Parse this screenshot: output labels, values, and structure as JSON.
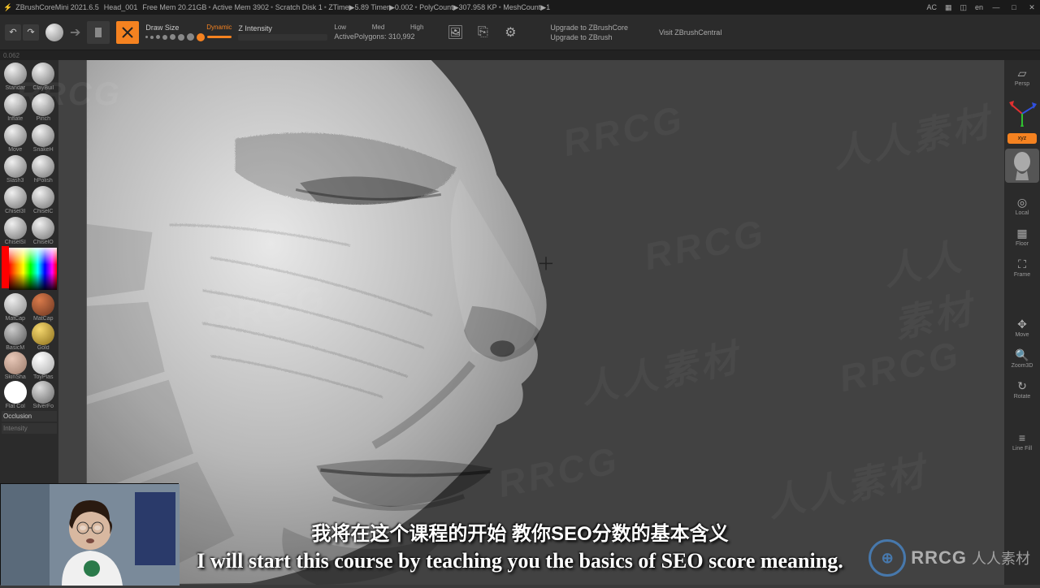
{
  "titlebar": {
    "app": "ZBrushCoreMini 2021.6.5",
    "doc": "Head_001",
    "items": [
      "Free Mem 20.21GB",
      "Active Mem 3902",
      "Scratch Disk 1",
      "ZTime▶5.89 Timer▶0.002",
      "PolyCount▶307.958 KP",
      "MeshCount▶1"
    ],
    "lang": "en",
    "ac": "AC"
  },
  "toolbar": {
    "draw_size_label": "Draw Size",
    "dynamic_label": "Dynamic",
    "z_intensity_label": "Z Intensity",
    "z_labels": [
      "Low",
      "Med",
      "High"
    ],
    "active_polygons_label": "ActivePolygons:",
    "active_polygons_value": "310,992",
    "upgrade1": "Upgrade to ZBrushCore",
    "upgrade2": "Upgrade to ZBrush",
    "visit": "Visit ZBrushCentral"
  },
  "info_line": "0.062",
  "brushes": [
    {
      "lbl": "Standar",
      "txt": ""
    },
    {
      "lbl": "ClayBuil",
      "txt": ""
    },
    {
      "lbl": "Inflate",
      "txt": ""
    },
    {
      "lbl": "Pinch",
      "txt": ""
    },
    {
      "lbl": "Move",
      "txt": ""
    },
    {
      "lbl": "SnakeH",
      "txt": ""
    },
    {
      "lbl": "Slash3",
      "txt": ""
    },
    {
      "lbl": "hPolish",
      "txt": ""
    },
    {
      "lbl": "Chisel3I",
      "txt": ""
    },
    {
      "lbl": "ChiselC",
      "txt": ""
    },
    {
      "lbl": "ChiselSI",
      "txt": ""
    },
    {
      "lbl": "ChiselO",
      "txt": ""
    }
  ],
  "materials": [
    {
      "lbl": "MatCap",
      "bg": "radial-gradient(circle at 35% 30%, #eee, #888)"
    },
    {
      "lbl": "MatCap",
      "bg": "radial-gradient(circle at 35% 30%, #d97a4a, #6a3520)"
    },
    {
      "lbl": "BasicM",
      "bg": "radial-gradient(circle at 35% 30%, #ccc, #555)"
    },
    {
      "lbl": "Gold",
      "bg": "radial-gradient(circle at 35% 30%, #f5d76e, #8a6d1a)"
    },
    {
      "lbl": "SkinSha",
      "bg": "radial-gradient(circle at 35% 30%, #e8c8b8, #9a7a6a)"
    },
    {
      "lbl": "ToyPlas",
      "bg": "radial-gradient(circle at 35% 30%, #fff, #aaa)"
    },
    {
      "lbl": "Flat Col",
      "bg": "radial-gradient(circle at 35% 30%, #fff, #fff)"
    },
    {
      "lbl": "SilverFo",
      "bg": "radial-gradient(circle at 35% 30%, #ddd, #666)"
    }
  ],
  "occlusion_label": "Occlusion",
  "intensity_label": "Intensity",
  "right_panel": [
    {
      "name": "persp",
      "lbl": "Persp",
      "ico": "▱"
    },
    {
      "name": "xyz",
      "lbl": "xyz",
      "ico": "",
      "active": true
    },
    {
      "name": "local",
      "lbl": "Local",
      "ico": "◎"
    },
    {
      "name": "floor",
      "lbl": "Floor",
      "ico": "▦"
    },
    {
      "name": "frame",
      "lbl": "Frame",
      "ico": "⛶"
    },
    {
      "name": "move",
      "lbl": "Move",
      "ico": "✥"
    },
    {
      "name": "zoom3d",
      "lbl": "Zoom3D",
      "ico": "🔍"
    },
    {
      "name": "rotate",
      "lbl": "Rotate",
      "ico": "↻"
    },
    {
      "name": "linefill",
      "lbl": "Line Fill",
      "ico": "≡"
    }
  ],
  "subtitles": {
    "cn": "我将在这个课程的开始 教你SEO分数的基本含义",
    "en": "I will start this course by teaching you the basics of SEO score meaning."
  },
  "watermark_text": "人人素材",
  "watermark_rrcg": "RRCG",
  "logo_text": "RRCG"
}
